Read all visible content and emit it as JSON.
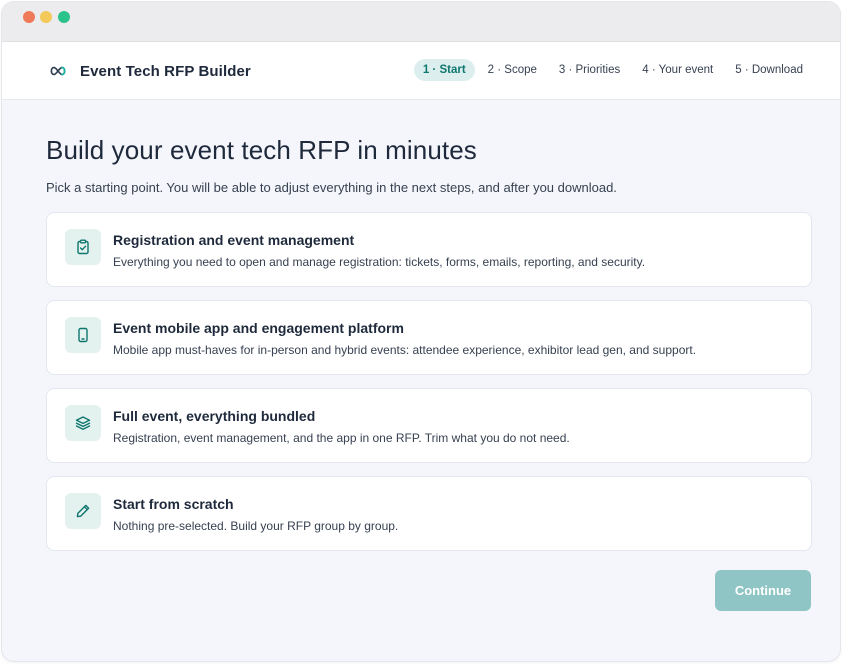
{
  "app": {
    "title": "Event Tech RFP Builder",
    "logo_icon": "infinity-icon",
    "accent_color": "#0f766e",
    "icon_bg": "#e3f1ef"
  },
  "steps": [
    {
      "label": "1 · Start",
      "active": true
    },
    {
      "label": "2 · Scope",
      "active": false
    },
    {
      "label": "3 · Priorities",
      "active": false
    },
    {
      "label": "4 · Your event",
      "active": false
    },
    {
      "label": "5 · Download",
      "active": false
    }
  ],
  "main": {
    "headline": "Build your event tech RFP in minutes",
    "subhead": "Pick a starting point. You will be able to adjust everything in the next steps, and after you download."
  },
  "options": [
    {
      "icon": "clipboard-check-icon",
      "title": "Registration and event management",
      "description": "Everything you need to open and manage registration: tickets, forms, emails, reporting, and security."
    },
    {
      "icon": "mobile-phone-icon",
      "title": "Event mobile app and engagement platform",
      "description": "Mobile app must-haves for in-person and hybrid events: attendee experience, exhibitor lead gen, and support."
    },
    {
      "icon": "layers-icon",
      "title": "Full event, everything bundled",
      "description": "Registration, event management, and the app in one RFP. Trim what you do not need."
    },
    {
      "icon": "pencil-icon",
      "title": "Start from scratch",
      "description": "Nothing pre-selected. Build your RFP group by group."
    }
  ],
  "footer": {
    "continue_label": "Continue",
    "continue_enabled": false
  }
}
